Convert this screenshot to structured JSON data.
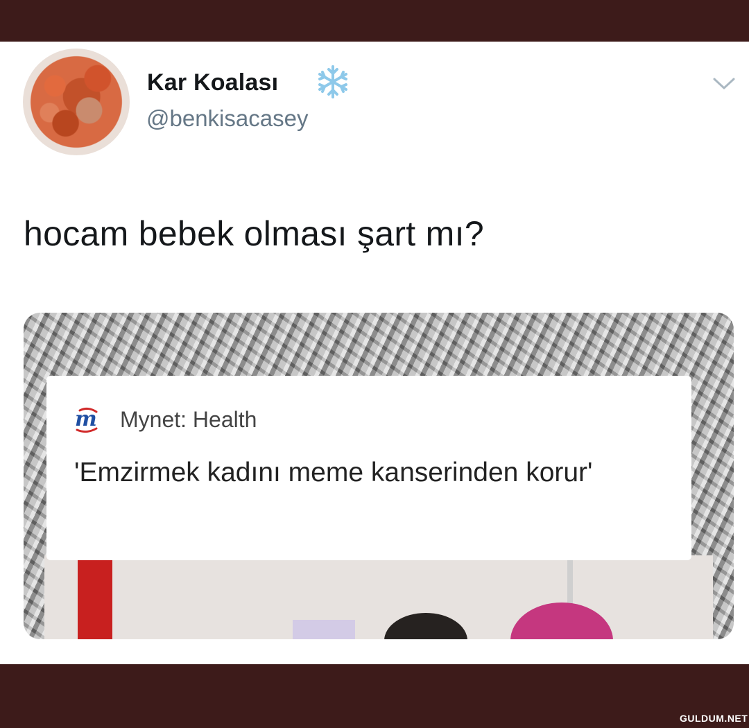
{
  "tweet": {
    "display_name": "Kar Koalası",
    "name_emoji_icon": "snowflake-icon",
    "handle": "@benkisacasey",
    "menu_icon": "chevron-down-icon",
    "text": "hocam bebek olması şart mı?"
  },
  "media": {
    "notification": {
      "app_icon": "mynet-logo-icon",
      "source": "Mynet: Health",
      "headline": "'Emzirmek kadını meme kanserinden korur'"
    }
  },
  "watermark": "GULDUM.NET",
  "colors": {
    "frame": "#3d1b1a",
    "text_primary": "#14171a",
    "text_secondary": "#657786",
    "logo_blue": "#1f4fa3",
    "logo_red": "#d12a2a"
  }
}
